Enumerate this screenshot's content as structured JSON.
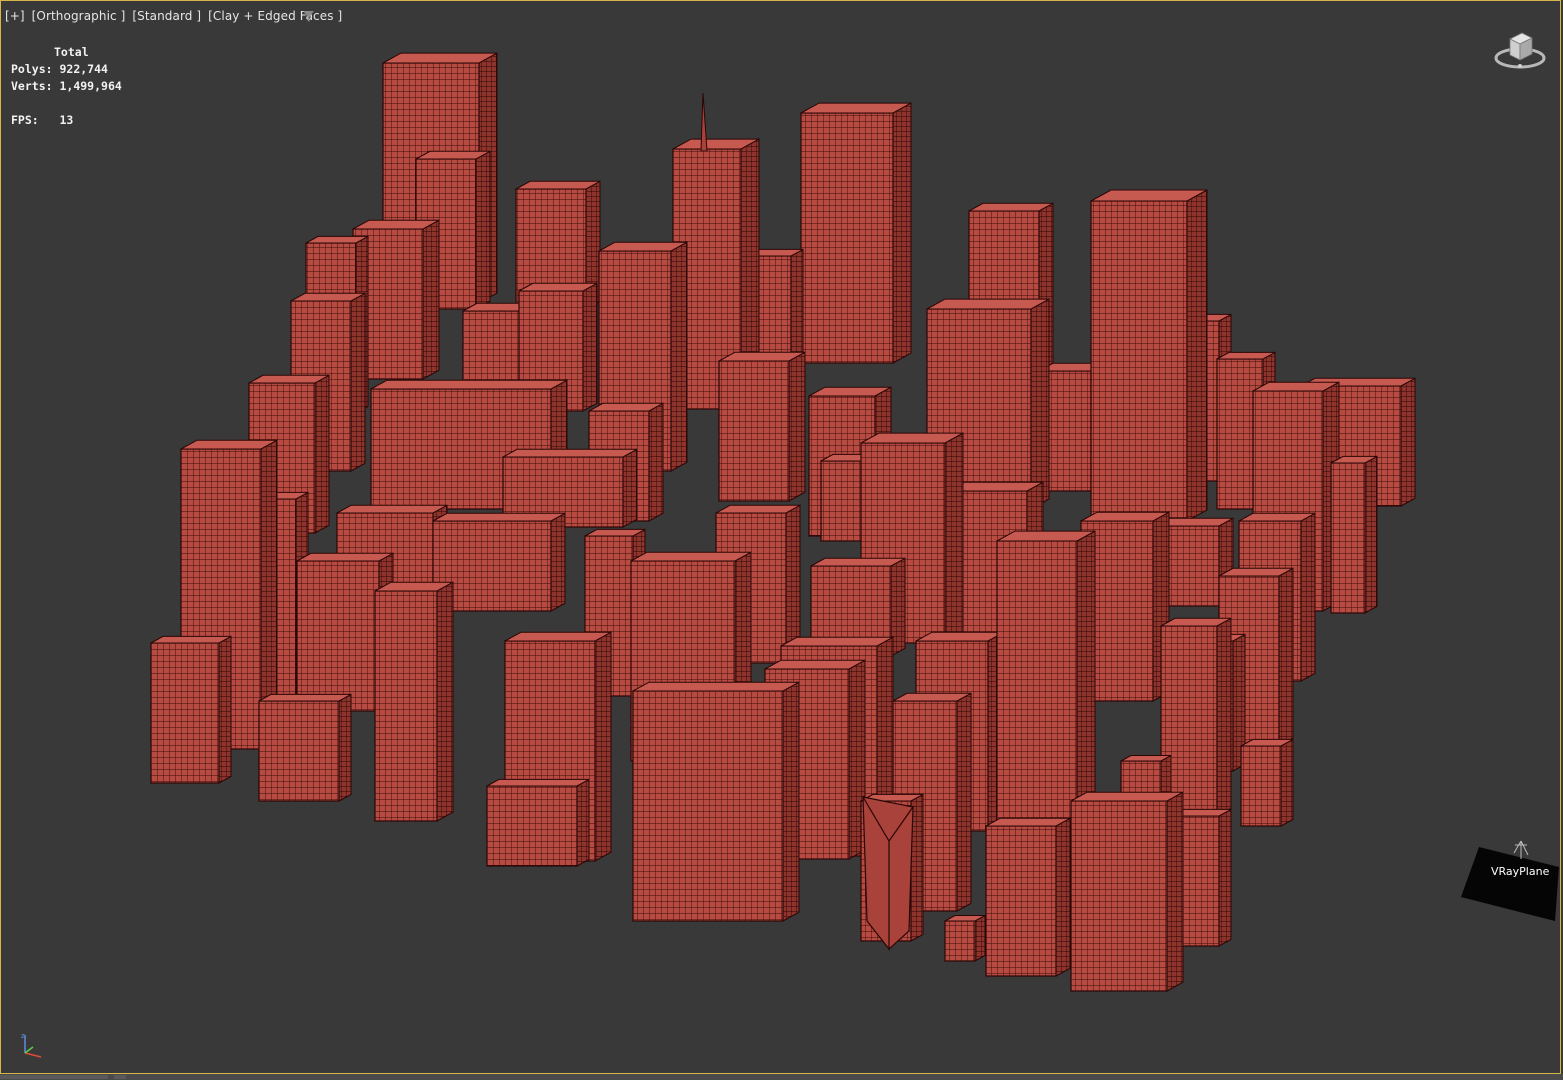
{
  "viewport": {
    "label_plus": "[+]",
    "label_view": "[Orthographic ]",
    "label_shading": "[Standard ]",
    "label_style": "[Clay + Edged Faces ]",
    "filter_icon": "funnel-icon"
  },
  "stats": {
    "total_label": "Total",
    "polys_label": "Polys:",
    "polys_value": "922,744",
    "verts_label": "Verts:",
    "verts_value": "1,499,964",
    "fps_label": "FPS:",
    "fps_value": "13"
  },
  "scene_object": {
    "label": "VRayPlane"
  },
  "colors": {
    "viewport_bg": "#393939",
    "active_border": "#d8b54a",
    "clay_face": "#b9473e",
    "clay_edge": "#2a0606",
    "clay_shadow": "#7a2b25"
  },
  "icons": {
    "viewcube": "viewcube-icon",
    "axis": "axis-tripod-icon"
  }
}
